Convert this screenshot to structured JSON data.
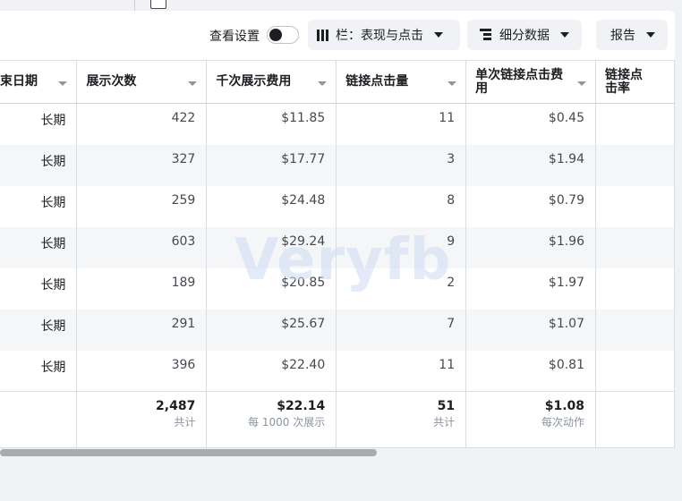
{
  "toolbar": {
    "view_settings_label": "查看设置",
    "columns_label": "栏：表现与点击",
    "breakdown_label": "细分数据",
    "reports_label": "报告"
  },
  "table": {
    "headers": [
      "束日期",
      "展示次数",
      "千次展示费用",
      "链接点击量",
      "单次链接点击费用",
      "链接点击率"
    ],
    "rows": [
      {
        "end": "长期",
        "impressions": "422",
        "cpm": "$11.85",
        "clicks": "11",
        "cpc": "$0.45"
      },
      {
        "end": "长期",
        "impressions": "327",
        "cpm": "$17.77",
        "clicks": "3",
        "cpc": "$1.94"
      },
      {
        "end": "长期",
        "impressions": "259",
        "cpm": "$24.48",
        "clicks": "8",
        "cpc": "$0.79"
      },
      {
        "end": "长期",
        "impressions": "603",
        "cpm": "$29.24",
        "clicks": "9",
        "cpc": "$1.96"
      },
      {
        "end": "长期",
        "impressions": "189",
        "cpm": "$20.85",
        "clicks": "2",
        "cpc": "$1.97"
      },
      {
        "end": "长期",
        "impressions": "291",
        "cpm": "$25.67",
        "clicks": "7",
        "cpc": "$1.07"
      },
      {
        "end": "长期",
        "impressions": "396",
        "cpm": "$22.40",
        "clicks": "11",
        "cpc": "$0.81"
      }
    ],
    "totals": {
      "impressions": "2,487",
      "impressions_label": "共计",
      "cpm": "$22.14",
      "cpm_label": "每 1000 次展示",
      "clicks": "51",
      "clicks_label": "共计",
      "cpc": "$1.08",
      "cpc_label": "每次动作"
    }
  },
  "watermark": "Veryfb",
  "icons": {
    "columns": "columns-icon",
    "breakdown": "breakdown-icon",
    "caret": "caret-down-icon",
    "sort": "sort-icon"
  }
}
